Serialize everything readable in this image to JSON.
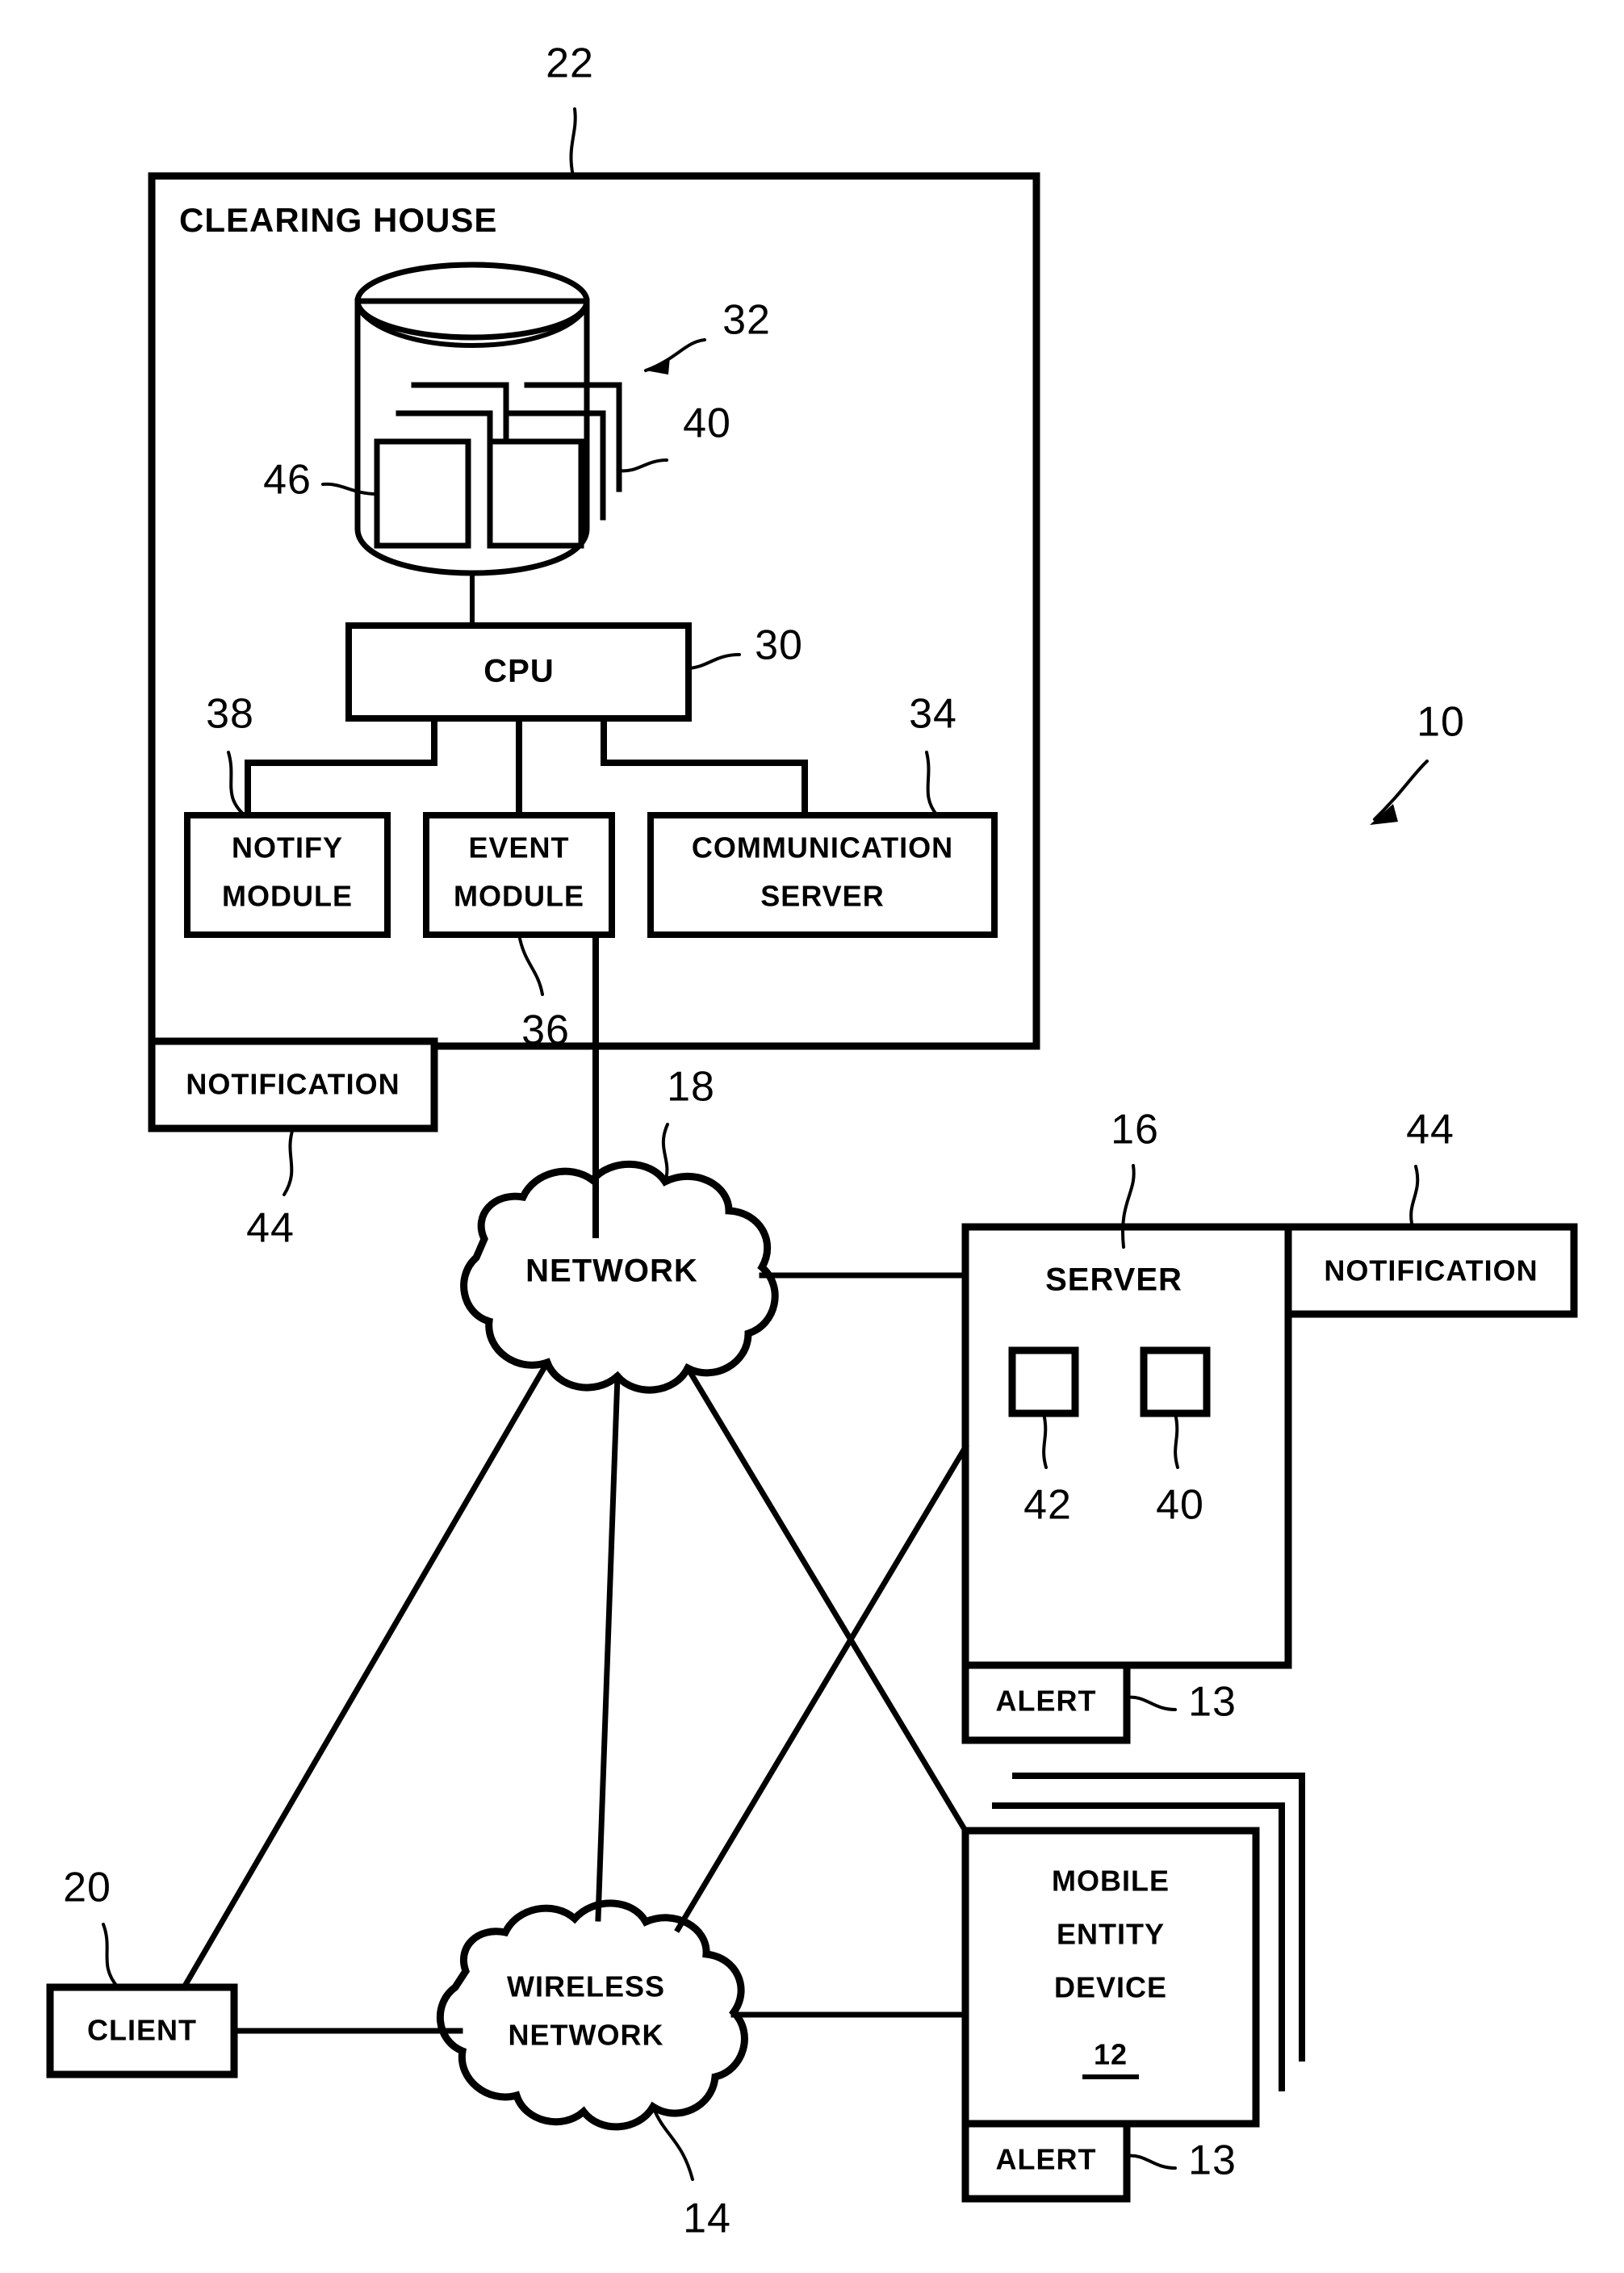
{
  "figure": {
    "type": "patent-block-diagram",
    "overall_ref": "10"
  },
  "clearing_house": {
    "title": "CLEARING HOUSE",
    "ref": "22",
    "database": {
      "ref": "32",
      "record_left_ref": "46",
      "record_right_ref": "40"
    },
    "cpu": {
      "label": "CPU",
      "ref": "30"
    },
    "modules": [
      {
        "label_line1": "NOTIFY",
        "label_line2": "MODULE",
        "ref": "38"
      },
      {
        "label_line1": "EVENT",
        "label_line2": "MODULE",
        "ref": "36"
      },
      {
        "label_line1": "COMMUNICATION",
        "label_line2": "SERVER",
        "ref": "34"
      }
    ],
    "notification": {
      "label": "NOTIFICATION",
      "ref": "44"
    }
  },
  "network": {
    "label": "NETWORK",
    "ref": "18"
  },
  "wireless_network": {
    "label_line1": "WIRELESS",
    "label_line2": "NETWORK",
    "ref": "14"
  },
  "client": {
    "label": "CLIENT",
    "ref": "20"
  },
  "server": {
    "label": "SERVER",
    "ref": "16",
    "inner_left_ref": "42",
    "inner_right_ref": "40",
    "alert": {
      "label": "ALERT",
      "ref": "13"
    },
    "notification": {
      "label": "NOTIFICATION",
      "ref": "44"
    }
  },
  "mobile_entity_device": {
    "label_line1": "MOBILE",
    "label_line2": "ENTITY",
    "label_line3": "DEVICE",
    "ref": "12",
    "alert": {
      "label": "ALERT",
      "ref": "13"
    }
  },
  "colors": {
    "ink": "#000000",
    "paper": "#ffffff"
  }
}
